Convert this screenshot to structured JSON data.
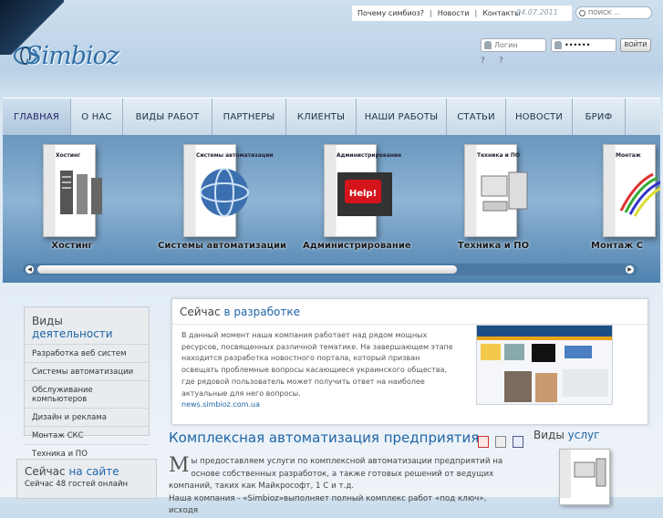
{
  "top_bar": {
    "why_link": "Почему симбиоз?",
    "news_link": "Новости",
    "contacts_link": "Контакты",
    "separator": "|",
    "date": "04.07.2011",
    "search_placeholder": "ПОИСК ..."
  },
  "logo": {
    "text": "Simbioz"
  },
  "login": {
    "login_placeholder": "Логин",
    "password_value": "••••••",
    "button_label": "ВОЙТИ",
    "help_glyph": "?"
  },
  "nav": {
    "items": [
      "ГЛАВНАЯ",
      "О НАС",
      "ВИДЫ РАБОТ",
      "ПАРТНЕРЫ",
      "КЛИЕНТЫ",
      "НАШИ РАБОТЫ",
      "СТАТЬИ",
      "НОВОСТИ",
      "БРИФ"
    ],
    "active": "ГЛАВНАЯ"
  },
  "slider": {
    "products": [
      {
        "caption": "Хостинг",
        "box_label": "Хостинг"
      },
      {
        "caption": "Системы автоматизации",
        "box_label": "Системы автоматизации"
      },
      {
        "caption": "Администрирование",
        "box_label": "Администрирование",
        "badge": "Help!"
      },
      {
        "caption": "Техника и ПО",
        "box_label": "Техника и ПО"
      },
      {
        "caption": "Монтаж С",
        "box_label": "Монтаж"
      }
    ],
    "scroll_left": "◀",
    "scroll_right": "▶"
  },
  "activities": {
    "title_plain": "Виды",
    "title_accent": "деятельности",
    "items": [
      "Разработка веб систем",
      "Системы автоматизации",
      "Обслуживание компьютеров",
      "Дизайн и реклама",
      "Монтаж СКС",
      "Техника и ПО"
    ]
  },
  "online": {
    "title_plain": "Сейчас",
    "title_accent": "на сайте",
    "text": "Сейчас 48 гостей онлайн"
  },
  "in_development": {
    "title_plain": "Сейчас",
    "title_accent": "в разработке",
    "text": "В данный момент наша компания работает над рядом мощных ресурсов, посвященных различной тематике. На завершающем этапе находится разработка новостного портала, который призван освещать проблемные вопросы касающиеся украинского общества, где рядовой пользователь может получить ответ на наиболее актуальные для него вопросы.",
    "link": "news.simbioz.com.ua"
  },
  "article": {
    "title": "Комплексная автоматизация предприятия",
    "dropcap": "М",
    "text": "ы предоставляем услуги по комплексной автоматизации предприятий на основе собственных разработок, а также готовых решений от ведущих компаний, таких как Майкрософт, 1 С и т.д.",
    "text2": "Наша компания - «Simbioz»выполняет полный комплекс работ «под ключ», исходя"
  },
  "services": {
    "title_plain": "Виды",
    "title_accent": "услуг"
  },
  "colors": {
    "accent": "#1f65a8",
    "nav_bg": "#d6e3ef",
    "slider_bg": "#6a97bf"
  }
}
